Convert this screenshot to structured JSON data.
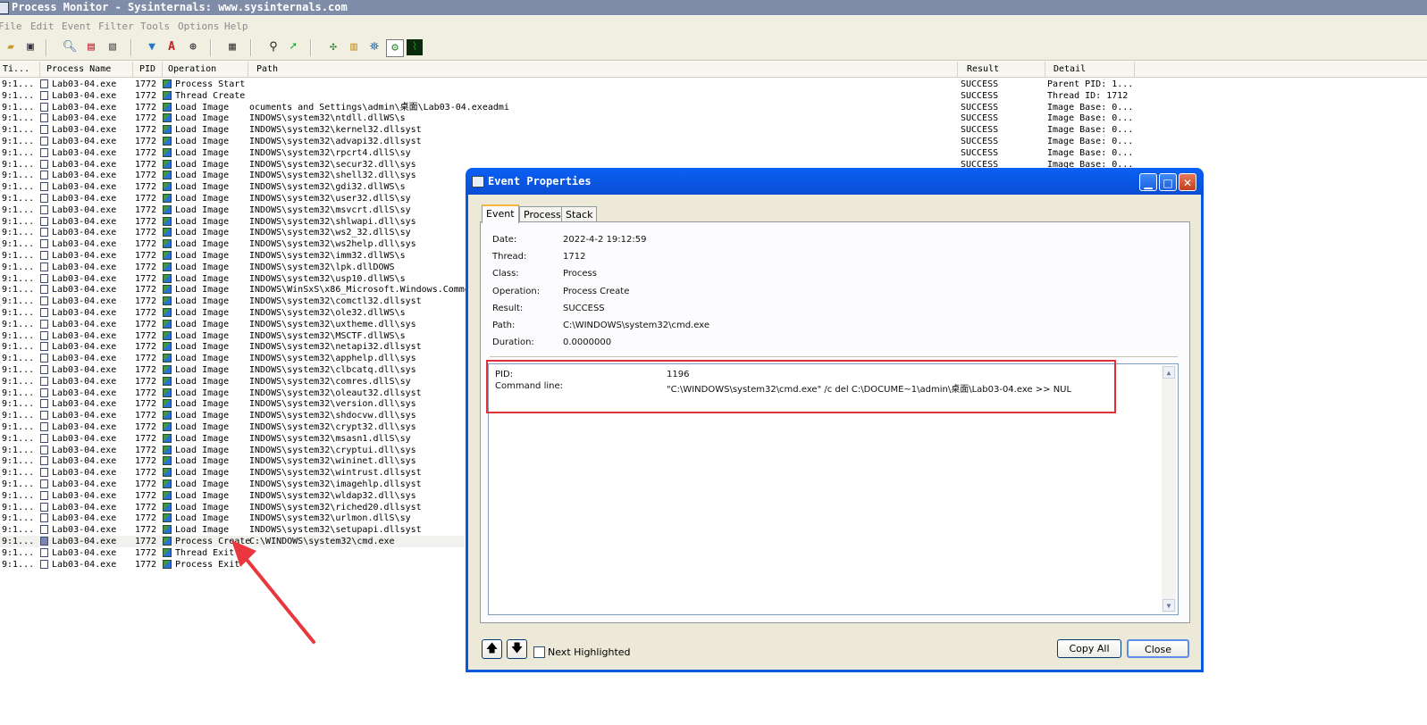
{
  "window": {
    "title": "Process Monitor - Sysinternals: www.sysinternals.com"
  },
  "menu": [
    "File",
    "Edit",
    "Event",
    "Filter",
    "Tools",
    "Options",
    "Help"
  ],
  "toolbar_icons": [
    "open-icon",
    "save-icon",
    "sep",
    "find-icon",
    "autoscroll-icon",
    "clear-icon",
    "sep",
    "filter-icon",
    "highlight-icon",
    "target-icon",
    "sep",
    "jump-icon",
    "sep",
    "binoculars-icon",
    "goto-icon",
    "sep",
    "registry-icon",
    "filesystem-icon",
    "network-icon",
    "process-icon",
    "profiling-icon"
  ],
  "columns": [
    "Ti...",
    "Process Name",
    "PID",
    "Operation",
    "Path",
    "Result",
    "Detail"
  ],
  "rows": [
    {
      "time": "9:1...",
      "process": "Lab03-04.exe",
      "pid": "1772",
      "op": "Process Start",
      "path": "",
      "result": "SUCCESS",
      "detail": "Parent PID: 1..."
    },
    {
      "time": "9:1...",
      "process": "Lab03-04.exe",
      "pid": "1772",
      "op": "Thread Create",
      "path": "",
      "result": "SUCCESS",
      "detail": "Thread ID: 1712"
    },
    {
      "time": "9:1...",
      "process": "Lab03-04.exe",
      "pid": "1772",
      "op": "Load Image",
      "path": "ocuments and Settings\\admin\\桌面\\Lab03-04.exeadmi",
      "result": "SUCCESS",
      "detail": "Image Base: 0..."
    },
    {
      "time": "9:1...",
      "process": "Lab03-04.exe",
      "pid": "1772",
      "op": "Load Image",
      "path": "INDOWS\\system32\\ntdll.dllWS\\s",
      "result": "SUCCESS",
      "detail": "Image Base: 0..."
    },
    {
      "time": "9:1...",
      "process": "Lab03-04.exe",
      "pid": "1772",
      "op": "Load Image",
      "path": "INDOWS\\system32\\kernel32.dllsyst",
      "result": "SUCCESS",
      "detail": "Image Base: 0..."
    },
    {
      "time": "9:1...",
      "process": "Lab03-04.exe",
      "pid": "1772",
      "op": "Load Image",
      "path": "INDOWS\\system32\\advapi32.dllsyst",
      "result": "SUCCESS",
      "detail": "Image Base: 0..."
    },
    {
      "time": "9:1...",
      "process": "Lab03-04.exe",
      "pid": "1772",
      "op": "Load Image",
      "path": "INDOWS\\system32\\rpcrt4.dllS\\sy",
      "result": "SUCCESS",
      "detail": "Image Base: 0..."
    },
    {
      "time": "9:1...",
      "process": "Lab03-04.exe",
      "pid": "1772",
      "op": "Load Image",
      "path": "INDOWS\\system32\\secur32.dll\\sys",
      "result": "SUCCESS",
      "detail": "Image Base: 0..."
    },
    {
      "time": "9:1...",
      "process": "Lab03-04.exe",
      "pid": "1772",
      "op": "Load Image",
      "path": "INDOWS\\system32\\shell32.dll\\sys",
      "result": "",
      "detail": ""
    },
    {
      "time": "9:1...",
      "process": "Lab03-04.exe",
      "pid": "1772",
      "op": "Load Image",
      "path": "INDOWS\\system32\\gdi32.dllWS\\s",
      "result": "",
      "detail": ""
    },
    {
      "time": "9:1...",
      "process": "Lab03-04.exe",
      "pid": "1772",
      "op": "Load Image",
      "path": "INDOWS\\system32\\user32.dllS\\sy",
      "result": "",
      "detail": ""
    },
    {
      "time": "9:1...",
      "process": "Lab03-04.exe",
      "pid": "1772",
      "op": "Load Image",
      "path": "INDOWS\\system32\\msvcrt.dllS\\sy",
      "result": "",
      "detail": ""
    },
    {
      "time": "9:1...",
      "process": "Lab03-04.exe",
      "pid": "1772",
      "op": "Load Image",
      "path": "INDOWS\\system32\\shlwapi.dll\\sys",
      "result": "",
      "detail": ""
    },
    {
      "time": "9:1...",
      "process": "Lab03-04.exe",
      "pid": "1772",
      "op": "Load Image",
      "path": "INDOWS\\system32\\ws2_32.dllS\\sy",
      "result": "",
      "detail": ""
    },
    {
      "time": "9:1...",
      "process": "Lab03-04.exe",
      "pid": "1772",
      "op": "Load Image",
      "path": "INDOWS\\system32\\ws2help.dll\\sys",
      "result": "",
      "detail": ""
    },
    {
      "time": "9:1...",
      "process": "Lab03-04.exe",
      "pid": "1772",
      "op": "Load Image",
      "path": "INDOWS\\system32\\imm32.dllWS\\s",
      "result": "",
      "detail": ""
    },
    {
      "time": "9:1...",
      "process": "Lab03-04.exe",
      "pid": "1772",
      "op": "Load Image",
      "path": "INDOWS\\system32\\lpk.dllDOWS",
      "result": "",
      "detail": ""
    },
    {
      "time": "9:1...",
      "process": "Lab03-04.exe",
      "pid": "1772",
      "op": "Load Image",
      "path": "INDOWS\\system32\\usp10.dllWS\\s",
      "result": "",
      "detail": ""
    },
    {
      "time": "9:1...",
      "process": "Lab03-04.exe",
      "pid": "1772",
      "op": "Load Image",
      "path": "INDOWS\\WinSxS\\x86_Microsoft.Windows.Commo",
      "result": "",
      "detail": ""
    },
    {
      "time": "9:1...",
      "process": "Lab03-04.exe",
      "pid": "1772",
      "op": "Load Image",
      "path": "INDOWS\\system32\\comctl32.dllsyst",
      "result": "",
      "detail": ""
    },
    {
      "time": "9:1...",
      "process": "Lab03-04.exe",
      "pid": "1772",
      "op": "Load Image",
      "path": "INDOWS\\system32\\ole32.dllWS\\s",
      "result": "",
      "detail": ""
    },
    {
      "time": "9:1...",
      "process": "Lab03-04.exe",
      "pid": "1772",
      "op": "Load Image",
      "path": "INDOWS\\system32\\uxtheme.dll\\sys",
      "result": "",
      "detail": ""
    },
    {
      "time": "9:1...",
      "process": "Lab03-04.exe",
      "pid": "1772",
      "op": "Load Image",
      "path": "INDOWS\\system32\\MSCTF.dllWS\\s",
      "result": "",
      "detail": ""
    },
    {
      "time": "9:1...",
      "process": "Lab03-04.exe",
      "pid": "1772",
      "op": "Load Image",
      "path": "INDOWS\\system32\\netapi32.dllsyst",
      "result": "",
      "detail": ""
    },
    {
      "time": "9:1...",
      "process": "Lab03-04.exe",
      "pid": "1772",
      "op": "Load Image",
      "path": "INDOWS\\system32\\apphelp.dll\\sys",
      "result": "",
      "detail": ""
    },
    {
      "time": "9:1...",
      "process": "Lab03-04.exe",
      "pid": "1772",
      "op": "Load Image",
      "path": "INDOWS\\system32\\clbcatq.dll\\sys",
      "result": "",
      "detail": ""
    },
    {
      "time": "9:1...",
      "process": "Lab03-04.exe",
      "pid": "1772",
      "op": "Load Image",
      "path": "INDOWS\\system32\\comres.dllS\\sy",
      "result": "",
      "detail": ""
    },
    {
      "time": "9:1...",
      "process": "Lab03-04.exe",
      "pid": "1772",
      "op": "Load Image",
      "path": "INDOWS\\system32\\oleaut32.dllsyst",
      "result": "",
      "detail": ""
    },
    {
      "time": "9:1...",
      "process": "Lab03-04.exe",
      "pid": "1772",
      "op": "Load Image",
      "path": "INDOWS\\system32\\version.dll\\sys",
      "result": "",
      "detail": ""
    },
    {
      "time": "9:1...",
      "process": "Lab03-04.exe",
      "pid": "1772",
      "op": "Load Image",
      "path": "INDOWS\\system32\\shdocvw.dll\\sys",
      "result": "",
      "detail": ""
    },
    {
      "time": "9:1...",
      "process": "Lab03-04.exe",
      "pid": "1772",
      "op": "Load Image",
      "path": "INDOWS\\system32\\crypt32.dll\\sys",
      "result": "",
      "detail": ""
    },
    {
      "time": "9:1...",
      "process": "Lab03-04.exe",
      "pid": "1772",
      "op": "Load Image",
      "path": "INDOWS\\system32\\msasn1.dllS\\sy",
      "result": "",
      "detail": ""
    },
    {
      "time": "9:1...",
      "process": "Lab03-04.exe",
      "pid": "1772",
      "op": "Load Image",
      "path": "INDOWS\\system32\\cryptui.dll\\sys",
      "result": "",
      "detail": ""
    },
    {
      "time": "9:1...",
      "process": "Lab03-04.exe",
      "pid": "1772",
      "op": "Load Image",
      "path": "INDOWS\\system32\\wininet.dll\\sys",
      "result": "",
      "detail": ""
    },
    {
      "time": "9:1...",
      "process": "Lab03-04.exe",
      "pid": "1772",
      "op": "Load Image",
      "path": "INDOWS\\system32\\wintrust.dllsyst",
      "result": "",
      "detail": ""
    },
    {
      "time": "9:1...",
      "process": "Lab03-04.exe",
      "pid": "1772",
      "op": "Load Image",
      "path": "INDOWS\\system32\\imagehlp.dllsyst",
      "result": "",
      "detail": ""
    },
    {
      "time": "9:1...",
      "process": "Lab03-04.exe",
      "pid": "1772",
      "op": "Load Image",
      "path": "INDOWS\\system32\\wldap32.dll\\sys",
      "result": "",
      "detail": ""
    },
    {
      "time": "9:1...",
      "process": "Lab03-04.exe",
      "pid": "1772",
      "op": "Load Image",
      "path": "INDOWS\\system32\\riched20.dllsyst",
      "result": "",
      "detail": ""
    },
    {
      "time": "9:1...",
      "process": "Lab03-04.exe",
      "pid": "1772",
      "op": "Load Image",
      "path": "INDOWS\\system32\\urlmon.dllS\\sy",
      "result": "",
      "detail": ""
    },
    {
      "time": "9:1...",
      "process": "Lab03-04.exe",
      "pid": "1772",
      "op": "Load Image",
      "path": "INDOWS\\system32\\setupapi.dllsyst",
      "result": "",
      "detail": ""
    },
    {
      "time": "9:1...",
      "process": "Lab03-04.exe",
      "pid": "1772",
      "op": "Process Create",
      "path": "C:\\WINDOWS\\system32\\cmd.exe",
      "result": "",
      "detail": "",
      "highlight": true
    },
    {
      "time": "9:1...",
      "process": "Lab03-04.exe",
      "pid": "1772",
      "op": "Thread Exit",
      "path": "",
      "result": "",
      "detail": ""
    },
    {
      "time": "9:1...",
      "process": "Lab03-04.exe",
      "pid": "1772",
      "op": "Process Exit",
      "path": "",
      "result": "",
      "detail": ""
    }
  ],
  "dialog": {
    "title": "Event Properties",
    "tabs": [
      "Event",
      "Process",
      "Stack"
    ],
    "fields": [
      {
        "label": "Date:",
        "value": "2022-4-2 19:12:59"
      },
      {
        "label": "Thread:",
        "value": "1712"
      },
      {
        "label": "Class:",
        "value": "Process"
      },
      {
        "label": "Operation:",
        "value": "Process Create"
      },
      {
        "label": "Result:",
        "value": "SUCCESS"
      },
      {
        "label": "Path:",
        "value": "C:\\WINDOWS\\system32\\cmd.exe"
      },
      {
        "label": "Duration:",
        "value": "0.0000000"
      }
    ],
    "details": [
      {
        "label": "PID:",
        "value": "1196"
      },
      {
        "label": "Command line:",
        "value": "\"C:\\WINDOWS\\system32\\cmd.exe\" /c del C:\\DOCUME~1\\admin\\桌面\\Lab03-04.exe >> NUL"
      }
    ],
    "next_highlighted_label": "Next Highlighted",
    "copy_all_label": "Copy All",
    "close_label": "Close",
    "up_glyph": "🡅",
    "down_glyph": "🡇"
  },
  "colors": {
    "dialog_frame": "#0a57e0",
    "annotation_red": "#e0313b"
  }
}
